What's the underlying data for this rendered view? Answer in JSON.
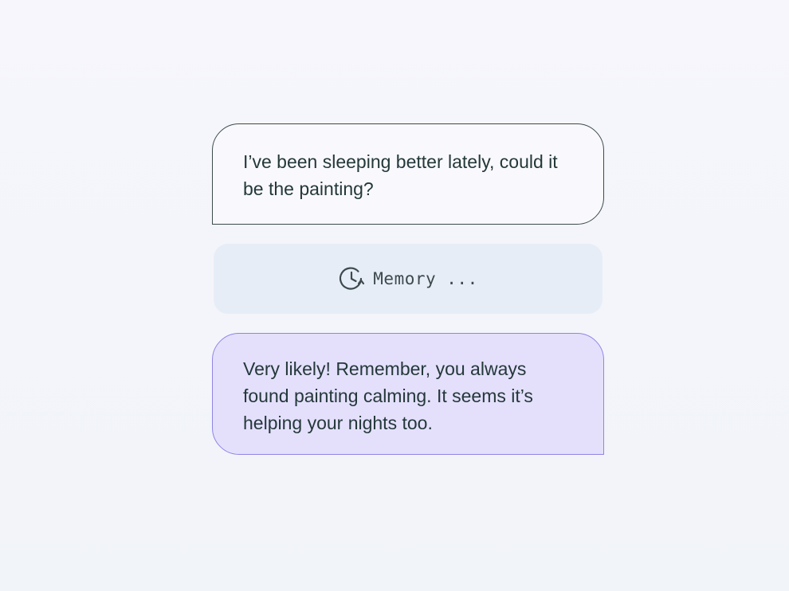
{
  "conversation": {
    "user_message": "I’ve been sleeping better lately, could it be the painting?",
    "memory_status": {
      "icon": "history-icon",
      "label": "Memory ..."
    },
    "assistant_message": "Very likely! Remember, you always found painting calming. It seems it’s helping your nights too."
  },
  "colors": {
    "user_bubble_bg": "#f9f9fd",
    "user_bubble_border": "#3b4a4a",
    "memory_bar_bg": "#e7edf6",
    "assistant_bubble_bg": "#e4e0fc",
    "assistant_bubble_border": "#8f84e6",
    "text": "#24383a"
  }
}
